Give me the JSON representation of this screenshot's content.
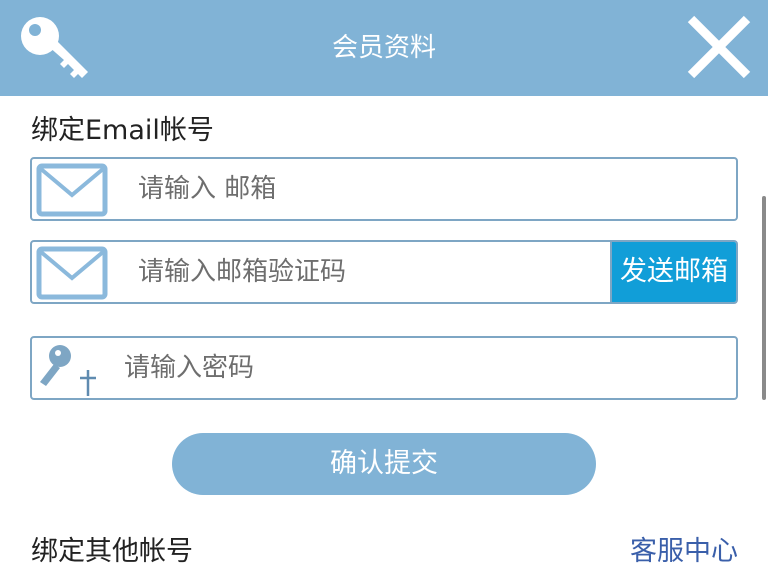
{
  "colors": {
    "header_bg": "#81b3d6",
    "primary_button": "#81b3d6",
    "send_button": "#119ed8",
    "field_border": "#7ea6c4",
    "link": "#3a5faa"
  },
  "header": {
    "title": "会员资料",
    "left_icon": "key-icon",
    "right_icon": "close-icon"
  },
  "email_section": {
    "title": "绑定Email帐号",
    "email_field": {
      "icon": "envelope-icon",
      "placeholder": "请输入 邮箱",
      "value": ""
    },
    "code_field": {
      "icon": "envelope-icon",
      "placeholder": "请输入邮箱验证码",
      "value": "",
      "send_button_label": "发送邮箱"
    },
    "password_field": {
      "icon": "key-add-icon",
      "placeholder": "请输入密码",
      "value": ""
    }
  },
  "submit_label": "确认提交",
  "footer": {
    "other_accounts_label": "绑定其他帐号",
    "service_link": "客服中心"
  }
}
